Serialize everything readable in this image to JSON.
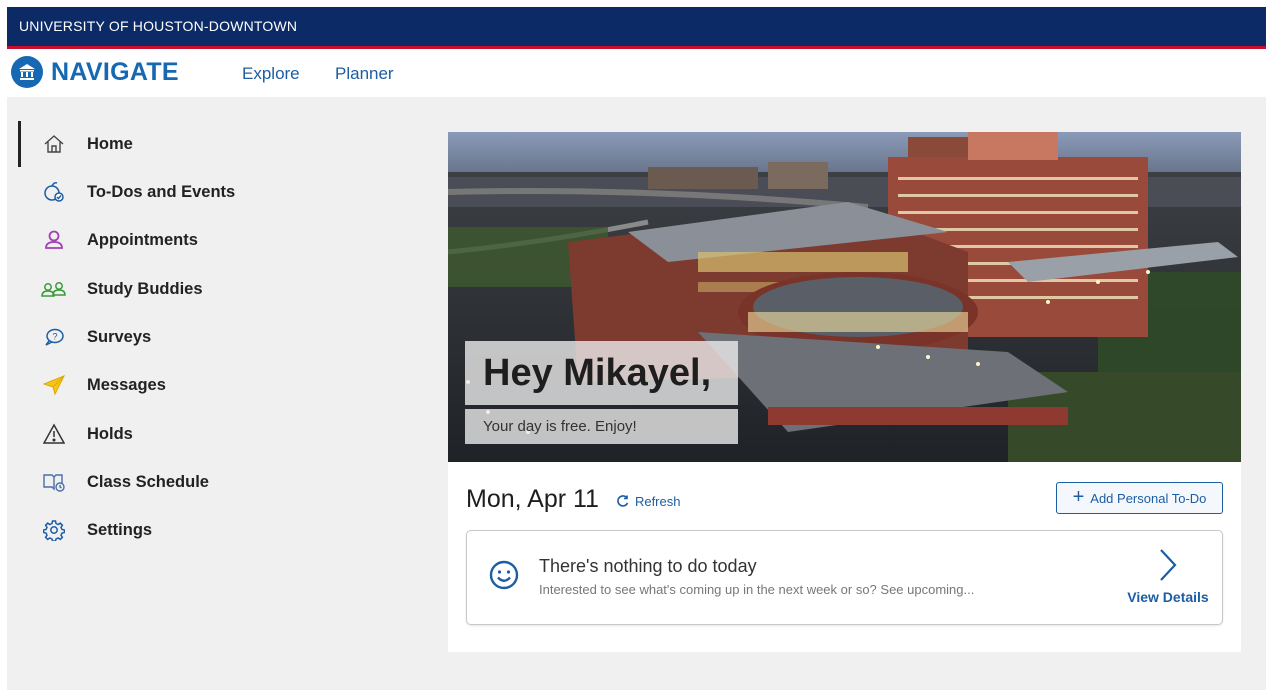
{
  "university_bar": {
    "title": "UNIVERSITY OF HOUSTON-DOWNTOWN"
  },
  "header": {
    "brand": "NAVIGATE",
    "nav_links": [
      "Explore",
      "Planner"
    ]
  },
  "sidebar": {
    "active_item": "Home",
    "items": [
      {
        "label": "Home",
        "icon": "home-icon"
      },
      {
        "label": "To-Dos and Events",
        "icon": "todo-icon"
      },
      {
        "label": "Appointments",
        "icon": "person-icon"
      },
      {
        "label": "Study Buddies",
        "icon": "study-buddies-icon"
      },
      {
        "label": "Surveys",
        "icon": "survey-bubble-icon"
      },
      {
        "label": "Messages",
        "icon": "paper-plane-icon"
      },
      {
        "label": "Holds",
        "icon": "warning-icon"
      },
      {
        "label": "Class Schedule",
        "icon": "class-schedule-icon"
      },
      {
        "label": "Settings",
        "icon": "gear-icon"
      }
    ]
  },
  "hero": {
    "greeting": "Hey Mikayel,",
    "subtitle": "Your day is free. Enjoy!"
  },
  "day": {
    "date": "Mon, Apr 11",
    "refresh_label": "Refresh",
    "add_button_label": "Add Personal To-Do"
  },
  "todo_card": {
    "title": "There's nothing to do today",
    "description": "Interested to see what's coming up in the next week or so? See upcoming...",
    "action_label": "View Details"
  },
  "colors": {
    "brand_navy": "#0b2a66",
    "accent_red": "#c8102e",
    "link_blue": "#1d5da3"
  }
}
